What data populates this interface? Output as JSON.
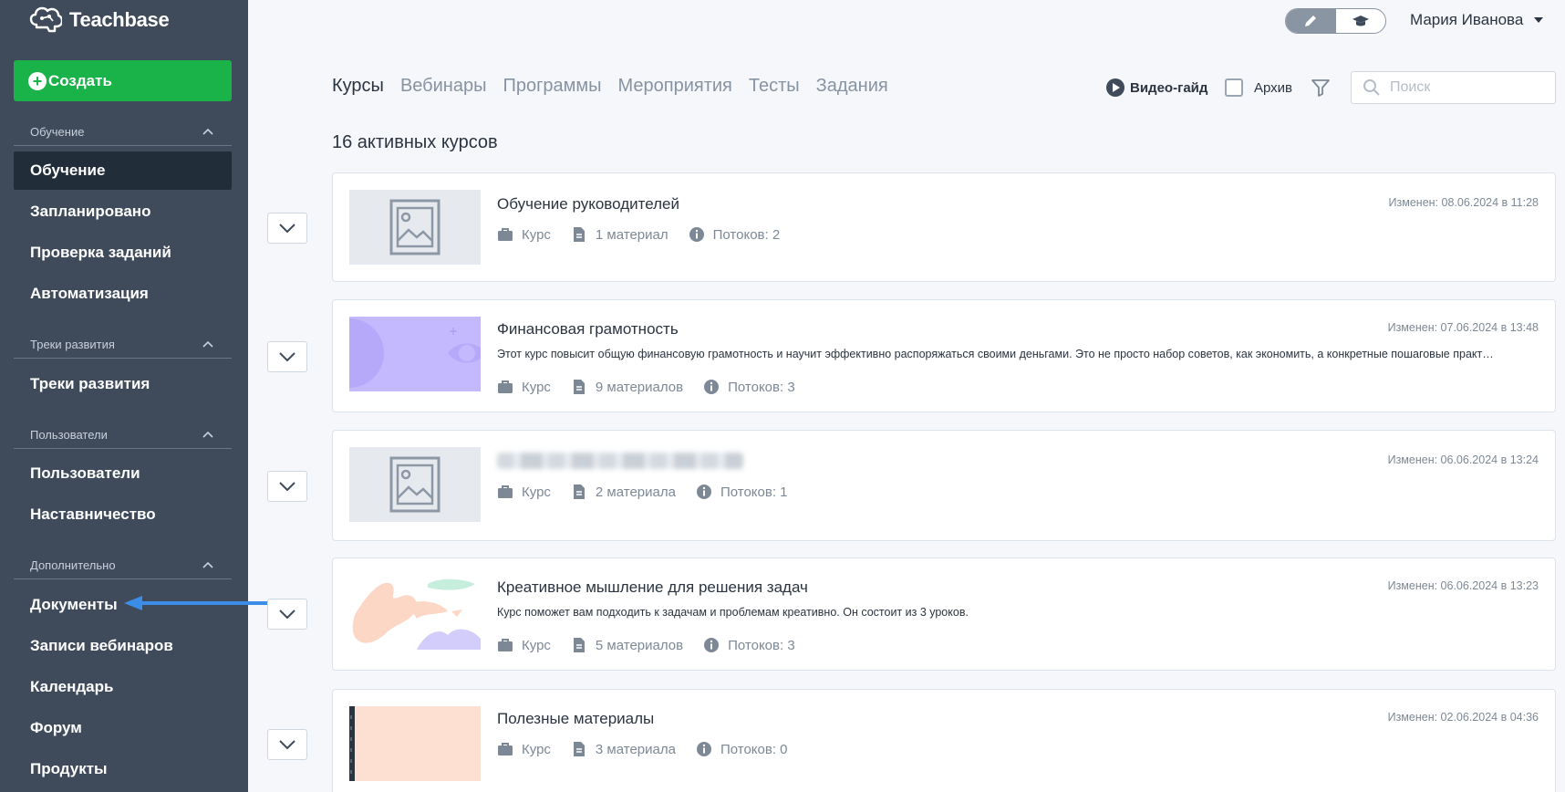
{
  "app": {
    "name": "Teachbase"
  },
  "sidebar": {
    "create_label": "Создать",
    "sections": [
      {
        "title": "Обучение",
        "items": [
          "Обучение",
          "Запланировано",
          "Проверка заданий",
          "Автоматизация"
        ]
      },
      {
        "title": "Треки развития",
        "items": [
          "Треки развития"
        ]
      },
      {
        "title": "Пользователи",
        "items": [
          "Пользователи",
          "Наставничество"
        ]
      },
      {
        "title": "Дополнительно",
        "items": [
          "Документы",
          "Записи вебинаров",
          "Календарь",
          "Форум",
          "Продукты"
        ]
      }
    ],
    "active_item": "Обучение"
  },
  "header": {
    "user_name": "Мария Иванова",
    "mode_icons": [
      "pencil-icon",
      "graduation-cap-icon"
    ],
    "active_mode": "edit"
  },
  "tabs": [
    "Курсы",
    "Вебинары",
    "Программы",
    "Мероприятия",
    "Тесты",
    "Задания"
  ],
  "active_tab": "Курсы",
  "toolbar": {
    "video_guide": "Видео-гайд",
    "archive": "Архив",
    "search_placeholder": "Поиск"
  },
  "courses_count": "16 активных курсов",
  "courses": [
    {
      "title": "Обучение руководителей",
      "description": "",
      "type": "Курс",
      "materials": "1 материал",
      "streams": "Потоков: 2",
      "modified": "Изменен: 08.06.2024 в 11:28",
      "thumb": "placeholder"
    },
    {
      "title": "Финансовая грамотность",
      "description": "Этот курс повысит общую финансовую грамотность и научит эффективно распоряжаться своими деньгами. Это не просто набор советов, как экономить, а конкретные пошаговые практ…",
      "type": "Курс",
      "materials": "9 материалов",
      "streams": "Потоков: 3",
      "modified": "Изменен: 07.06.2024 в 13:48",
      "thumb": "purple"
    },
    {
      "title": "",
      "description": "",
      "type": "Курс",
      "materials": "2 материала",
      "streams": "Потоков: 1",
      "modified": "Изменен: 06.06.2024 в 13:24",
      "thumb": "placeholder",
      "title_blurred": true
    },
    {
      "title": "Креативное мышление для решения задач",
      "description": "Курс поможет вам подходить к задачам и проблемам креативно. Он состоит из 3 уроков.",
      "type": "Курс",
      "materials": "5 материалов",
      "streams": "Потоков: 3",
      "modified": "Изменен: 06.06.2024 в 13:23",
      "thumb": "creative"
    },
    {
      "title": "Полезные материалы",
      "description": "",
      "type": "Курс",
      "materials": "3 материала",
      "streams": "Потоков: 0",
      "modified": "Изменен: 02.06.2024 в 04:36",
      "thumb": "peach"
    }
  ],
  "colors": {
    "sidebar": "#3f4b5b",
    "active_nav": "#222d3a",
    "create_button": "#1ab34a",
    "arrow": "#3b8de8",
    "background": "#f5f7fa"
  }
}
